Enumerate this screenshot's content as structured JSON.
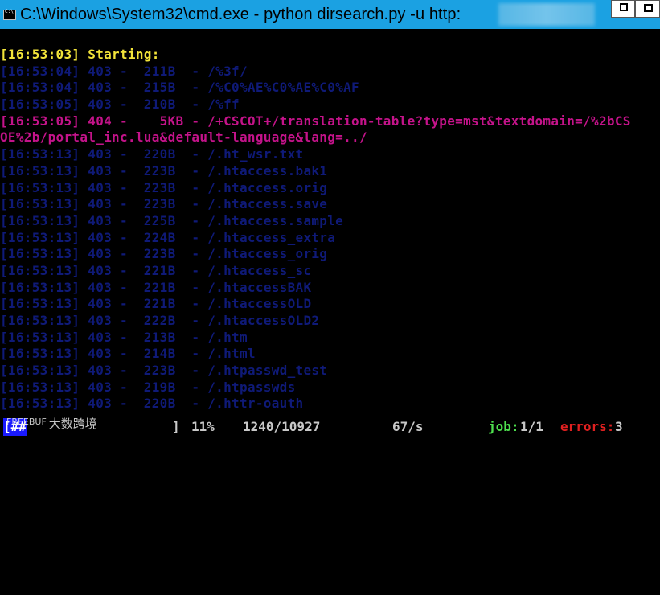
{
  "window": {
    "title": "C:\\Windows\\System32\\cmd.exe - python  dirsearch.py -u http:",
    "colors": {
      "titlebar": "#1ba1e2",
      "yellow": "#f2e43a",
      "dim": "#0f1a78",
      "magenta": "#c4138a",
      "green": "#4ee04e",
      "red": "#e02020"
    }
  },
  "console": {
    "lines": [
      {
        "text": "[16:53:03] Starting: ",
        "style": "yellow"
      },
      {
        "text": "[16:53:04] 403 -  211B  - /%3f/",
        "style": "dim"
      },
      {
        "text": "[16:53:04] 403 -  215B  - /%C0%AE%C0%AE%C0%AF",
        "style": "dim"
      },
      {
        "text": "[16:53:05] 403 -  210B  - /%ff",
        "style": "dim"
      },
      {
        "text": "[16:53:05] 404 -    5KB - /+CSCOT+/translation-table?type=mst&textdomain=/%2bCS",
        "style": "magenta"
      },
      {
        "text": "OE%2b/portal_inc.lua&default-language&lang=../",
        "style": "magenta"
      },
      {
        "text": "[16:53:13] 403 -  220B  - /.ht_wsr.txt",
        "style": "dim"
      },
      {
        "text": "[16:53:13] 403 -  223B  - /.htaccess.bak1",
        "style": "dim"
      },
      {
        "text": "[16:53:13] 403 -  223B  - /.htaccess.orig",
        "style": "dim"
      },
      {
        "text": "[16:53:13] 403 -  223B  - /.htaccess.save",
        "style": "dim"
      },
      {
        "text": "[16:53:13] 403 -  225B  - /.htaccess.sample",
        "style": "dim"
      },
      {
        "text": "[16:53:13] 403 -  224B  - /.htaccess_extra",
        "style": "dim"
      },
      {
        "text": "[16:53:13] 403 -  223B  - /.htaccess_orig",
        "style": "dim"
      },
      {
        "text": "[16:53:13] 403 -  221B  - /.htaccess_sc",
        "style": "dim"
      },
      {
        "text": "[16:53:13] 403 -  221B  - /.htaccessBAK",
        "style": "dim"
      },
      {
        "text": "[16:53:13] 403 -  221B  - /.htaccessOLD",
        "style": "dim"
      },
      {
        "text": "[16:53:13] 403 -  222B  - /.htaccessOLD2",
        "style": "dim"
      },
      {
        "text": "[16:53:13] 403 -  213B  - /.htm",
        "style": "dim"
      },
      {
        "text": "[16:53:13] 403 -  214B  - /.html",
        "style": "dim"
      },
      {
        "text": "[16:53:13] 403 -  223B  - /.htpasswd_test",
        "style": "dim"
      },
      {
        "text": "[16:53:13] 403 -  219B  - /.htpasswds",
        "style": "dim"
      },
      {
        "text": "[16:53:13] 403 -  220B  - /.httr-oauth",
        "style": "dim"
      }
    ]
  },
  "status": {
    "bracket_open": "[##",
    "bracket_close": "]",
    "percent": "11%",
    "progress": "1240/10927",
    "rate": "67/s",
    "job_label": "job:",
    "job_value": "1/1",
    "errors_label": "errors:",
    "errors_value": "3"
  },
  "watermark": {
    "logo": "FREEBUF",
    "text": "大数跨境"
  }
}
